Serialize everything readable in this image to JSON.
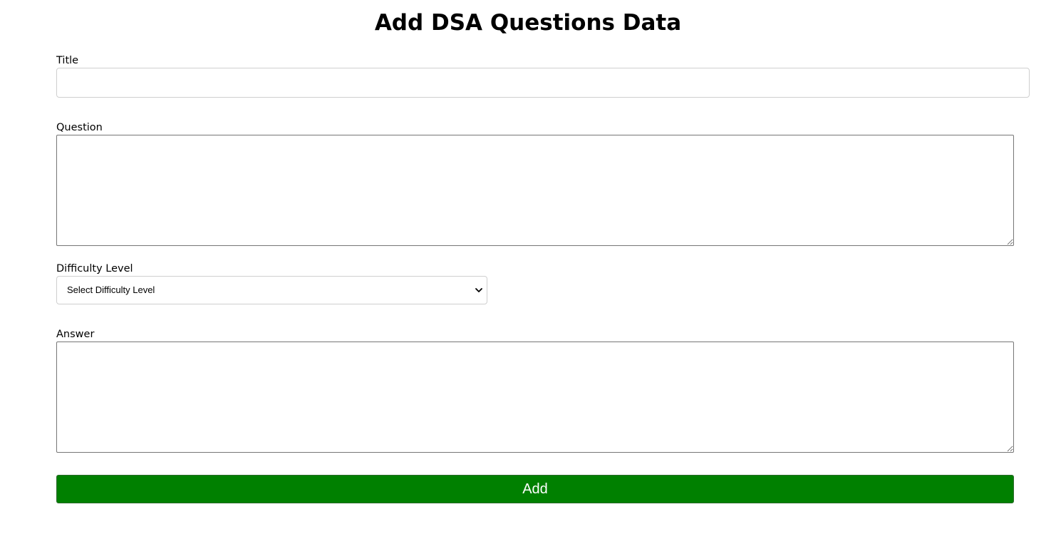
{
  "page": {
    "title": "Add DSA Questions Data"
  },
  "form": {
    "title": {
      "label": "Title",
      "value": "",
      "placeholder": ""
    },
    "question": {
      "label": "Question",
      "value": ""
    },
    "difficulty": {
      "label": "Difficulty Level",
      "selected": "Select Difficulty Level",
      "icon": "chevron-down-icon"
    },
    "answer": {
      "label": "Answer",
      "value": ""
    },
    "submit": {
      "label": "Add",
      "color": "#008000"
    }
  }
}
